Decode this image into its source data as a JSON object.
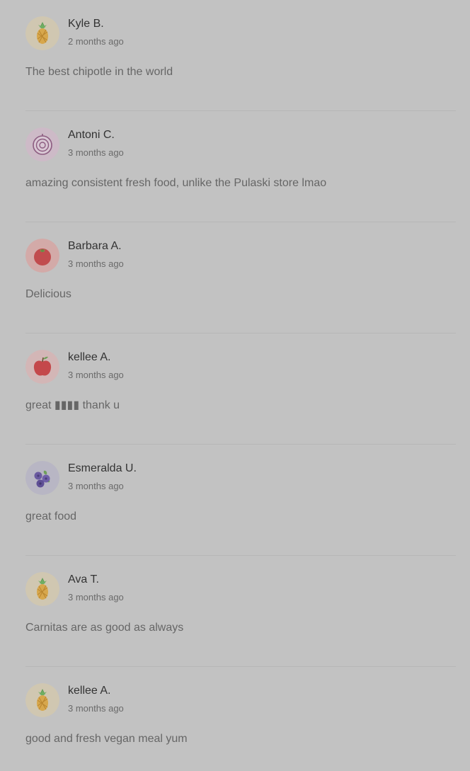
{
  "reviews": [
    {
      "name": "Kyle B.",
      "time": "2 months ago",
      "text": "The best chipotle in the world",
      "avatar": "pineapple-icon"
    },
    {
      "name": "Antoni C.",
      "time": "3 months ago",
      "text": "amazing consistent fresh food, unlike the Pulaski store lmao",
      "avatar": "onion-icon"
    },
    {
      "name": "Barbara A.",
      "time": "3 months ago",
      "text": "Delicious",
      "avatar": "tomato-icon"
    },
    {
      "name": "kellee A.",
      "time": "3 months ago",
      "text": "great ▮▮▮▮ thank u",
      "avatar": "apple-icon"
    },
    {
      "name": "Esmeralda U.",
      "time": "3 months ago",
      "text": "great food",
      "avatar": "blueberries-icon"
    },
    {
      "name": "Ava T.",
      "time": "3 months ago",
      "text": "Carnitas are as good as always",
      "avatar": "pineapple-icon"
    },
    {
      "name": "kellee A.",
      "time": "3 months ago",
      "text": "good and fresh vegan meal yum",
      "avatar": "pineapple-icon"
    }
  ],
  "colors": {
    "background": "#c2c2c2",
    "name": "#333333",
    "time": "#6a6a6a",
    "text": "#666666",
    "divider": "#b6b6b6"
  }
}
